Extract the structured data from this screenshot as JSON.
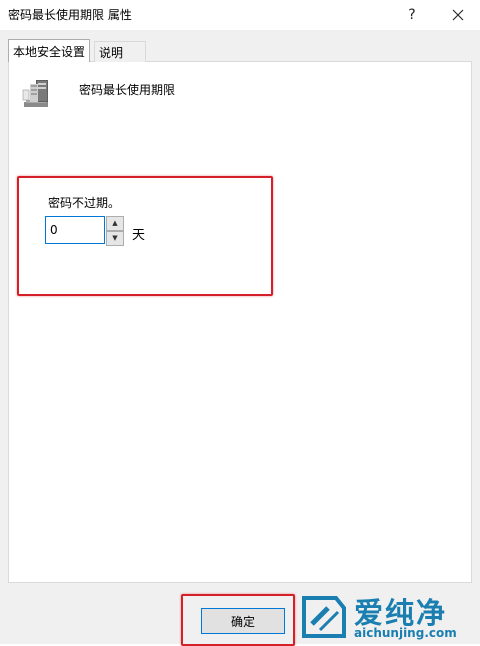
{
  "window": {
    "title": "密码最长使用期限 属性",
    "help_label": "?"
  },
  "tabs": [
    {
      "label": "本地安全设置",
      "active": true
    },
    {
      "label": "说明",
      "active": false
    }
  ],
  "policy": {
    "name": "密码最长使用期限",
    "icon": "server-policy-icon"
  },
  "setting": {
    "label": "密码不过期。",
    "value": "0",
    "unit": "天"
  },
  "buttons": {
    "ok_label": "确定"
  },
  "watermark": {
    "title": "爱纯净",
    "url": "aichunjing.com"
  },
  "colors": {
    "highlight_box": "#d5202a",
    "focus_border": "#0078d7",
    "watermark": "#1a7fb0"
  }
}
